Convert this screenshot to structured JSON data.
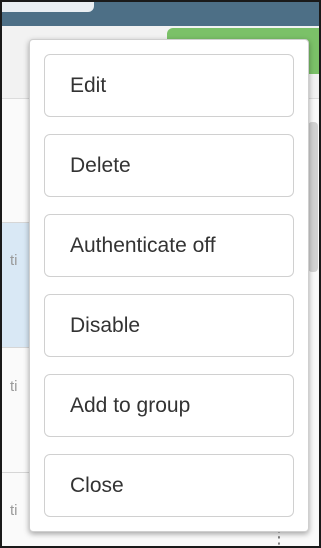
{
  "menu": {
    "items": [
      {
        "label": "Edit"
      },
      {
        "label": "Delete"
      },
      {
        "label": "Authenticate off"
      },
      {
        "label": "Disable"
      },
      {
        "label": "Add to group"
      },
      {
        "label": "Close"
      }
    ]
  },
  "background": {
    "row_fragment": "ti"
  },
  "colors": {
    "accent_green": "#7bc168",
    "top_bar": "#4d6f86",
    "menu_border": "#d0d0d0",
    "text": "#333333"
  }
}
